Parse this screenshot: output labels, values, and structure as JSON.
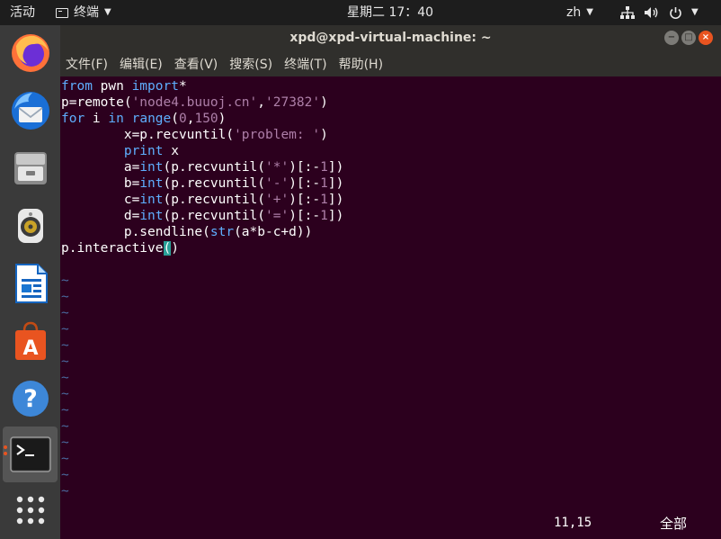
{
  "topbar": {
    "activities": "活动",
    "app_name": "终端",
    "clock": "星期二 17：40",
    "lang": "zh"
  },
  "dock": {
    "items": [
      "firefox-icon",
      "thunderbird-icon",
      "files-icon",
      "rhythmbox-icon",
      "writer-icon",
      "software-icon",
      "help-icon",
      "terminal-icon",
      "apps-grid-icon"
    ]
  },
  "window": {
    "title": "xpd@xpd-virtual-machine: ~",
    "menu": [
      "文件(F)",
      "编辑(E)",
      "查看(V)",
      "搜索(S)",
      "终端(T)",
      "帮助(H)"
    ]
  },
  "editor": {
    "lines": [
      "from pwn import*",
      "p=remote('node4.buuoj.cn','27382')",
      "for i in range(0,150)",
      "        x=p.recvuntil('problem: ')",
      "        print x",
      "        a=int(p.recvuntil('*')[:-1])",
      "        b=int(p.recvuntil('-')[:-1])",
      "        c=int(p.recvuntil('+')[:-1])",
      "        d=int(p.recvuntil('=')[:-1])",
      "        p.sendline(str(a*b-c+d))",
      "p.interactive()"
    ],
    "tilde": "~",
    "cursor_pos": "11,15",
    "scroll_indicator": "全部"
  },
  "colors": {
    "terminal_bg": "#2c001e",
    "keyword": "#5fafff",
    "string": "#ad7fa8",
    "tilde": "#4a6a9e",
    "cursor": "#2aa198"
  }
}
